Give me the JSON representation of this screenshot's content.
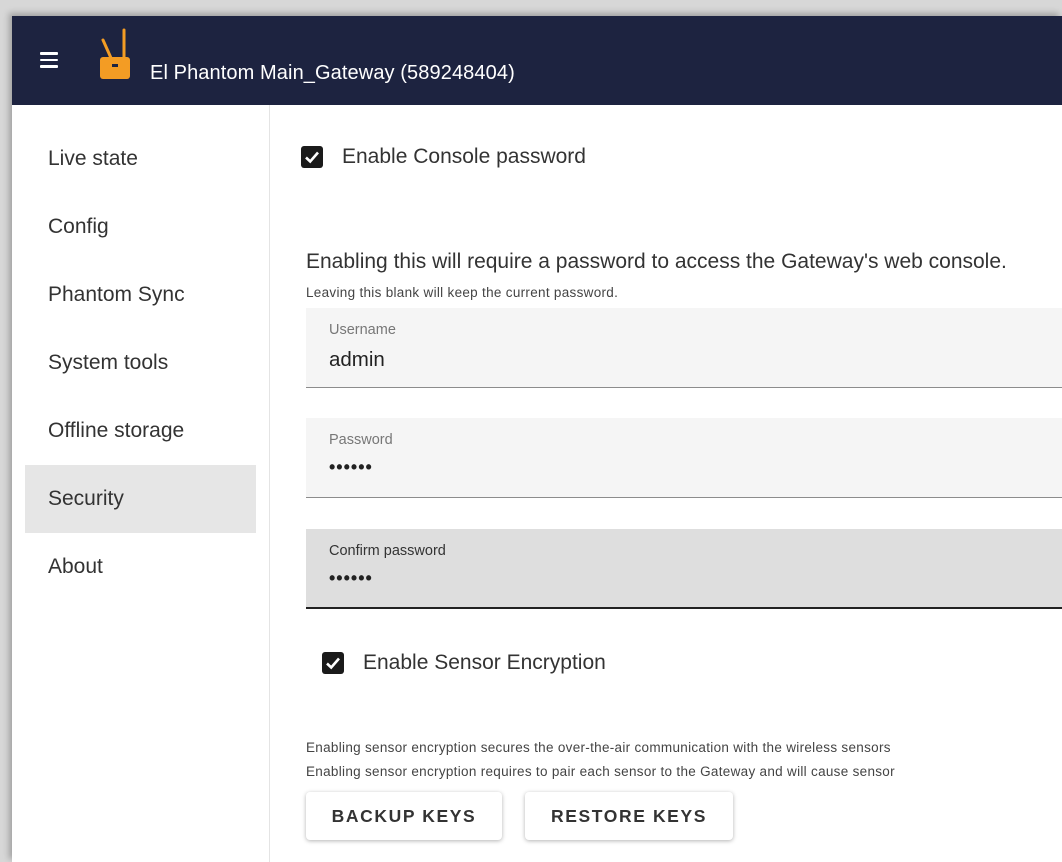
{
  "header": {
    "title": "El Phantom Main_Gateway (589248404)",
    "menu_icon": "hamburger-menu-icon",
    "logo_icon": "gateway-logo-icon",
    "background": "#1d2340",
    "logo_color": "#f39c24"
  },
  "sidebar": {
    "items": [
      {
        "label": "Live state",
        "active": false
      },
      {
        "label": "Config",
        "active": false
      },
      {
        "label": "Phantom Sync",
        "active": false
      },
      {
        "label": "System tools",
        "active": false
      },
      {
        "label": "Offline storage",
        "active": false
      },
      {
        "label": "Security",
        "active": true
      },
      {
        "label": "About",
        "active": false
      }
    ]
  },
  "security": {
    "console_password": {
      "checkbox_label": "Enable Console password",
      "checked": true,
      "description": "Enabling this will require a password to access the Gateway's web console.",
      "hint": "Leaving this blank will keep the current password.",
      "username": {
        "label": "Username",
        "value": "admin"
      },
      "password": {
        "label": "Password",
        "value": "••••••"
      },
      "confirm_password": {
        "label": "Confirm password",
        "value": "••••••"
      }
    },
    "sensor_encryption": {
      "checkbox_label": "Enable Sensor Encryption",
      "checked": true,
      "description_1": "Enabling sensor encryption secures the over-the-air communication with the wireless sensors",
      "description_2": "Enabling sensor encryption requires to pair each sensor to the Gateway and will cause sensor",
      "backup_button": "BACKUP KEYS",
      "restore_button": "RESTORE KEYS"
    }
  }
}
